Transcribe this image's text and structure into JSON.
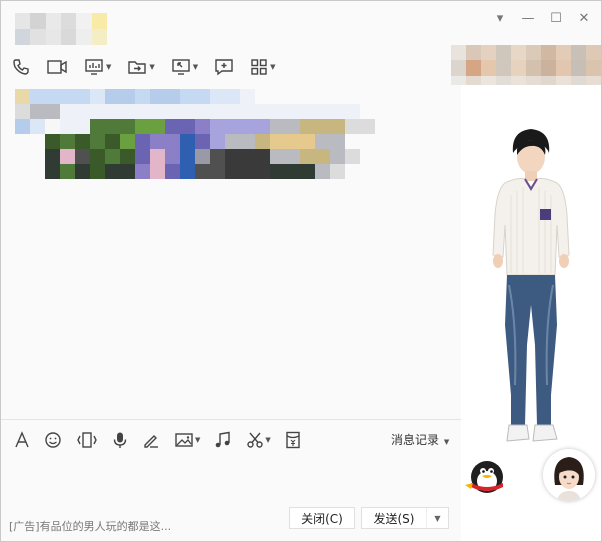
{
  "window": {
    "controls": [
      "▾",
      "—",
      "☐",
      "✕"
    ]
  },
  "title_colors": [
    "#e6e6e6",
    "#d3d3d3",
    "#e9e9e9",
    "#dcdcdc",
    "#f1f1f1",
    "#f8eba8",
    "#d0d6dc",
    "#e1e1e1",
    "#e7e7e7",
    "#d9d9d9",
    "#eeeeee",
    "#f5eec4"
  ],
  "profile_colors": [
    "#e8e3dc",
    "#d9c8b8",
    "#e4d1bf",
    "#cfc6bc",
    "#e6d7c6",
    "#dccab9",
    "#d1b8a3",
    "#e2ccb7",
    "#c9c1b8",
    "#ddc9b6",
    "#dcd5cd",
    "#d6a586",
    "#e3c8ad",
    "#d2c7bc",
    "#e6d2bd",
    "#d3c1ae",
    "#cbb29d",
    "#e2c7ae",
    "#c6bfb8",
    "#dbc4ae",
    "#ebe9e6",
    "#e4dad0",
    "#ece5dd",
    "#e2ddd6",
    "#ebe3d9",
    "#e5ddd3",
    "#e0d7cd",
    "#ebe1d6",
    "#dfdad4",
    "#e7ddd2"
  ],
  "toolbar": {
    "items": [
      {
        "name": "voice-call-icon",
        "caret": false
      },
      {
        "name": "video-call-icon",
        "caret": false
      },
      {
        "name": "screen-share-icon",
        "caret": true
      },
      {
        "name": "file-transfer-icon",
        "caret": true
      },
      {
        "name": "remote-assist-icon",
        "caret": true
      },
      {
        "name": "create-discussion-icon",
        "caret": false
      },
      {
        "name": "app-grid-icon",
        "caret": true
      }
    ]
  },
  "input_toolbar": {
    "items": [
      {
        "name": "font-icon",
        "caret": false
      },
      {
        "name": "emoji-icon",
        "caret": false
      },
      {
        "name": "shake-icon",
        "caret": false
      },
      {
        "name": "voice-message-icon",
        "caret": false
      },
      {
        "name": "handwriting-icon",
        "caret": false
      },
      {
        "name": "image-icon",
        "caret": true
      },
      {
        "name": "music-icon",
        "caret": false
      },
      {
        "name": "screenshot-icon",
        "caret": true
      },
      {
        "name": "red-packet-icon",
        "caret": false
      }
    ],
    "history_label": "消息记录"
  },
  "footer": {
    "ad_text": "[广告]有品位的男人玩的都是这...",
    "close_label": "关闭(C)",
    "send_label": "发送(S)"
  }
}
